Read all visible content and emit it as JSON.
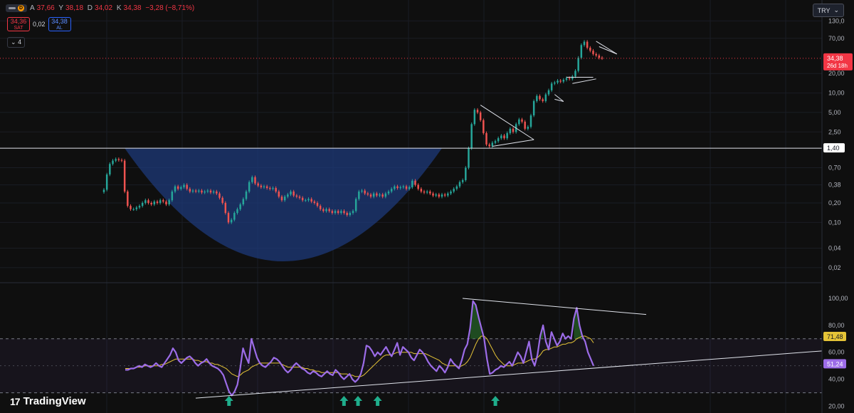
{
  "header": {
    "interval": "D",
    "open_label": "A",
    "open": "37,66",
    "high_label": "Y",
    "high": "38,18",
    "low_label": "D",
    "low": "34,02",
    "close_label": "K",
    "close": "34,38",
    "change": "−3,28 (−8,71%)"
  },
  "trade": {
    "sell_price": "34,36",
    "sell_label": "SAT",
    "spread": "0,02",
    "buy_price": "34,38",
    "buy_label": "AL"
  },
  "legend_count": "4",
  "currency": "TRY",
  "brand": "TradingView",
  "colors": {
    "bg": "#0f0f0f",
    "up": "#26a69a",
    "down": "#ef5350",
    "bowl": "#1e3a7a",
    "rsi": "#9c6ce8",
    "rsi_ma": "#e5c437",
    "price_tag": "#f23645",
    "arrow": "#1fae8c"
  },
  "chart_data": [
    {
      "type": "candlestick",
      "panel": "price",
      "y_scale": "log",
      "ylim": [
        0.012,
        260
      ],
      "y_ticks": [
        "130,0",
        "70,00",
        "20,00",
        "10,00",
        "5,00",
        "2,50",
        "0,70",
        "0,38",
        "0,20",
        "0,10",
        "0,04",
        "0,02"
      ],
      "tick_values": [
        130,
        70,
        20,
        10,
        5,
        2.5,
        0.7,
        0.38,
        0.2,
        0.1,
        0.04,
        0.02
      ],
      "last_price": "34,38",
      "last_price_value": 34.38,
      "countdown": "26d 18h",
      "support_level": "1,40",
      "support_value": 1.4,
      "closes": [
        0.32,
        0.55,
        0.8,
        0.9,
        0.95,
        0.92,
        0.9,
        0.3,
        0.18,
        0.16,
        0.16,
        0.17,
        0.18,
        0.2,
        0.22,
        0.2,
        0.19,
        0.21,
        0.2,
        0.22,
        0.21,
        0.19,
        0.22,
        0.3,
        0.36,
        0.33,
        0.35,
        0.38,
        0.33,
        0.3,
        0.31,
        0.3,
        0.31,
        0.29,
        0.3,
        0.31,
        0.29,
        0.3,
        0.28,
        0.24,
        0.2,
        0.14,
        0.1,
        0.11,
        0.14,
        0.16,
        0.19,
        0.23,
        0.3,
        0.42,
        0.5,
        0.4,
        0.37,
        0.35,
        0.36,
        0.34,
        0.33,
        0.34,
        0.3,
        0.25,
        0.22,
        0.25,
        0.27,
        0.3,
        0.26,
        0.25,
        0.24,
        0.22,
        0.22,
        0.23,
        0.21,
        0.2,
        0.18,
        0.16,
        0.15,
        0.16,
        0.15,
        0.14,
        0.15,
        0.14,
        0.15,
        0.14,
        0.13,
        0.14,
        0.15,
        0.23,
        0.3,
        0.31,
        0.28,
        0.27,
        0.25,
        0.28,
        0.26,
        0.27,
        0.25,
        0.28,
        0.3,
        0.33,
        0.36,
        0.34,
        0.35,
        0.36,
        0.33,
        0.35,
        0.44,
        0.38,
        0.33,
        0.3,
        0.29,
        0.3,
        0.28,
        0.26,
        0.27,
        0.25,
        0.27,
        0.26,
        0.28,
        0.3,
        0.33,
        0.36,
        0.42,
        0.45,
        0.7,
        1.4,
        3.3,
        5.5,
        5.0,
        3.8,
        2.4,
        1.6,
        1.5,
        1.7,
        1.8,
        2.0,
        2.2,
        2.0,
        2.4,
        2.8,
        2.5,
        3.3,
        3.9,
        3.6,
        2.8,
        3.0,
        4.5,
        7.5,
        9.0,
        8.0,
        7.5,
        9.5,
        11.0,
        14.0,
        14.5,
        15.5,
        15.0,
        16.0,
        17.0,
        16.5,
        18.0,
        22.0,
        35.0,
        55.0,
        62.0,
        50.0,
        45.0,
        40.0,
        38.0,
        35.0,
        34.38
      ]
    },
    {
      "type": "line",
      "panel": "rsi",
      "ylim": [
        15,
        110
      ],
      "y_ticks": [
        "100,00",
        "80,00",
        "60,00",
        "40,00",
        "20,00"
      ],
      "tick_values": [
        100,
        80,
        60,
        40,
        20
      ],
      "band": [
        30,
        70
      ],
      "series": [
        {
          "values": [
            47,
            47,
            48,
            48,
            49,
            50,
            49,
            51,
            50,
            49,
            50,
            52,
            50,
            49,
            52,
            55,
            58,
            63,
            60,
            54,
            52,
            54,
            56,
            57,
            55,
            52,
            50,
            52,
            53,
            55,
            52,
            50,
            49,
            48,
            46,
            43,
            37,
            31,
            28,
            31,
            36,
            48,
            63,
            57,
            52,
            70,
            63,
            56,
            52,
            50,
            49,
            51,
            53,
            56,
            55,
            53,
            50,
            47,
            45,
            47,
            50,
            52,
            50,
            48,
            47,
            45,
            44,
            46,
            45,
            43,
            42,
            44,
            46,
            44,
            43,
            47,
            45,
            42,
            40,
            42,
            44,
            40,
            38,
            40,
            44,
            52,
            65,
            64,
            61,
            57,
            60,
            58,
            61,
            64,
            60,
            57,
            62,
            67,
            58,
            64,
            62,
            60,
            56,
            54,
            58,
            62,
            60,
            57,
            53,
            50,
            48,
            46,
            50,
            48,
            45,
            49,
            55,
            52,
            50,
            48,
            54,
            62,
            66,
            78,
            98,
            95,
            86,
            78,
            70,
            55,
            44,
            45,
            47,
            48,
            50,
            49,
            51,
            53,
            50,
            55,
            60,
            57,
            52,
            60,
            68,
            55,
            50,
            58,
            72,
            80,
            68,
            62,
            75,
            70,
            65,
            68,
            74,
            70,
            72,
            70,
            85,
            93,
            80,
            72,
            68,
            60,
            55,
            50
          ],
          "color": "#9c6ce8"
        },
        {
          "values": [
            48,
            48,
            48,
            48,
            49,
            49,
            49,
            50,
            50,
            50,
            50,
            50,
            50,
            51,
            51,
            52,
            53,
            54,
            55,
            55,
            55,
            55,
            55,
            55,
            55,
            54,
            54,
            53,
            53,
            53,
            52,
            52,
            51,
            51,
            50,
            49,
            48,
            46,
            44,
            43,
            42,
            43,
            45,
            46,
            47,
            49,
            50,
            51,
            52,
            52,
            52,
            52,
            52,
            52,
            52,
            52,
            51,
            50,
            49,
            49,
            49,
            49,
            49,
            49,
            48,
            48,
            47,
            47,
            46,
            46,
            45,
            45,
            45,
            45,
            45,
            45,
            45,
            44,
            44,
            44,
            43,
            43,
            42,
            42,
            42,
            43,
            45,
            47,
            49,
            51,
            53,
            55,
            57,
            58,
            58,
            58,
            59,
            60,
            60,
            60,
            60,
            60,
            60,
            59,
            59,
            59,
            59,
            59,
            58,
            57,
            56,
            55,
            54,
            52,
            51,
            50,
            50,
            50,
            50,
            49,
            50,
            51,
            53,
            56,
            61,
            66,
            70,
            72,
            72,
            70,
            66,
            62,
            58,
            55,
            53,
            51,
            50,
            50,
            50,
            51,
            52,
            52,
            52,
            53,
            54,
            55,
            55,
            56,
            58,
            61,
            62,
            62,
            63,
            64,
            64,
            65,
            66,
            66,
            67,
            67,
            68,
            70,
            71,
            72,
            72,
            71,
            70,
            67
          ],
          "color": "#e5c437"
        }
      ],
      "rsi_last": "51,24",
      "ma_last": "71,48",
      "rsi_last_value": 51.24,
      "ma_last_value": 71.48
    }
  ]
}
